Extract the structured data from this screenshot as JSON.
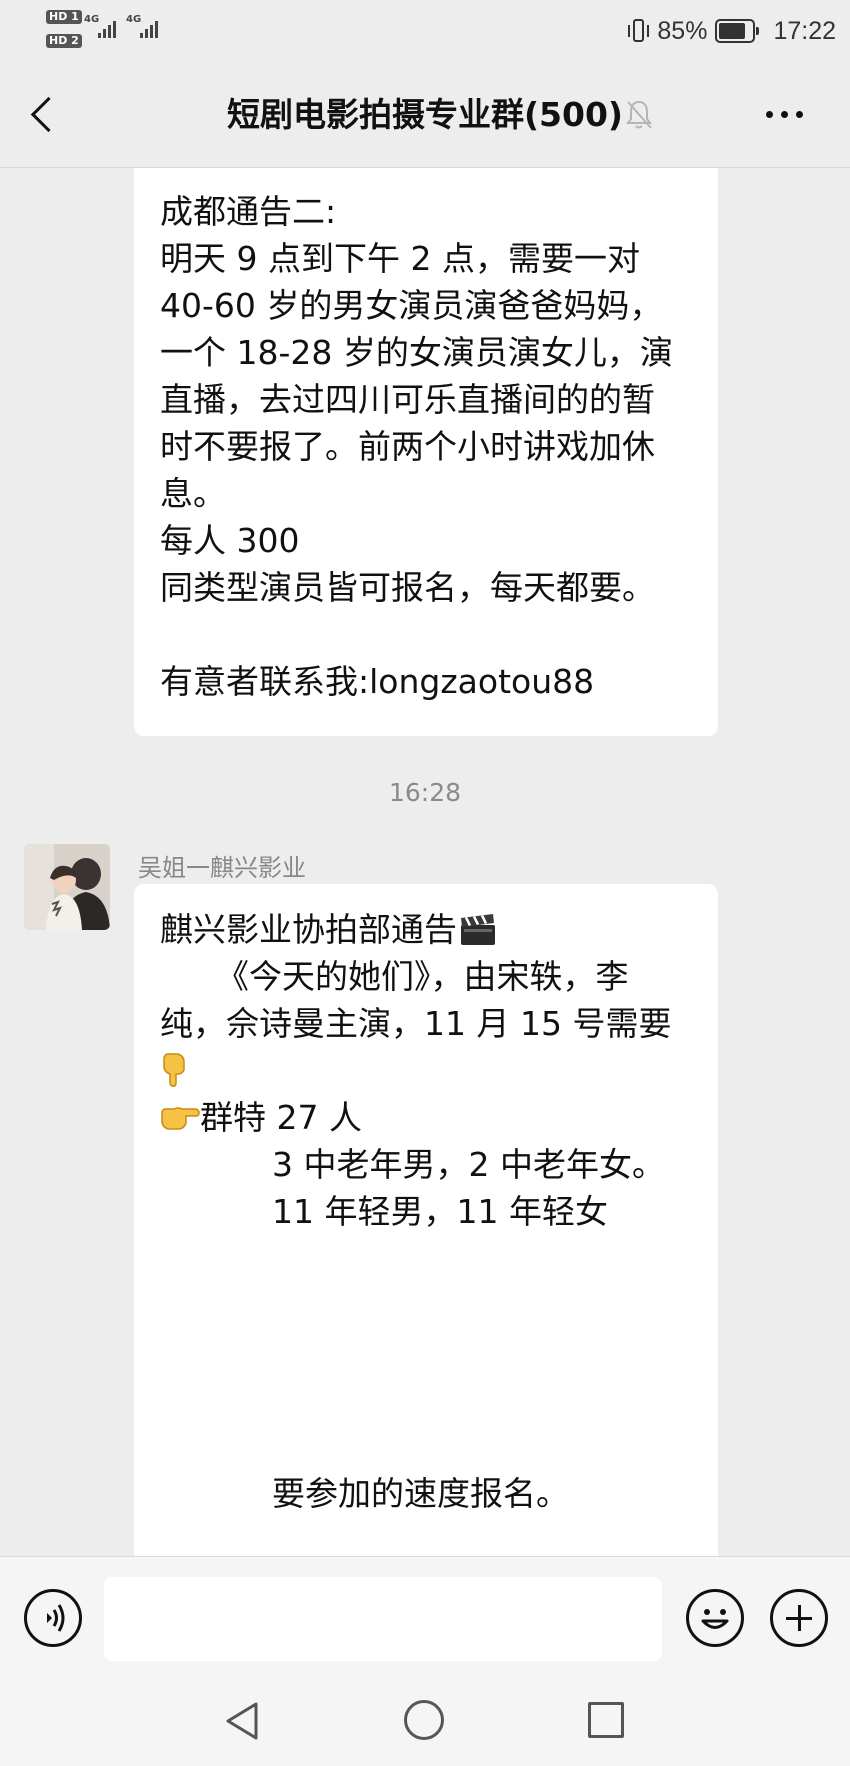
{
  "status_bar": {
    "sim1": "HD 1",
    "sim2": "HD 2",
    "net1": "4G",
    "net2": "4G",
    "battery_percent": "85%",
    "battery_level": 0.85,
    "time": "17:22"
  },
  "header": {
    "title": "短剧电影拍摄专业群(500)"
  },
  "messages": {
    "first": {
      "text": "成都通告二:\n明天 9 点到下午 2 点，需要一对\n40-60 岁的男女演员演爸爸妈妈，\n一个 18-28 岁的女演员演女儿，演\n直播，去过四川可乐直播间的的暂\n时不要报了。前两个小时讲戏加休\n息。\n每人 300\n同类型演员皆可报名，每天都要。\n\n有意者联系我:longzaotou88"
    },
    "timestamp": "16:28",
    "second": {
      "sender": "吴姐一麒兴影业",
      "line1": "麒兴影业协拍部通告",
      "line2": "《今天的她们》，由宋轶，李",
      "line3": "纯，佘诗曼主演，11 月 15 号需要",
      "line5": "群特 27 人",
      "line6": "3 中老年男，2 中老年女。",
      "line7": "11 年轻男，11 年轻女",
      "line8": "要参加的速度报名。"
    }
  },
  "input_bar": {
    "placeholder": ""
  },
  "icons": {
    "back": "chevron-left-icon",
    "mute": "bell-muted-icon",
    "more": "more-dots-icon",
    "voice": "voice-icon",
    "emoji": "smiley-icon",
    "add": "plus-icon"
  },
  "colors": {
    "background": "#ededed",
    "bubble": "#ffffff",
    "muted_text": "#888888"
  }
}
